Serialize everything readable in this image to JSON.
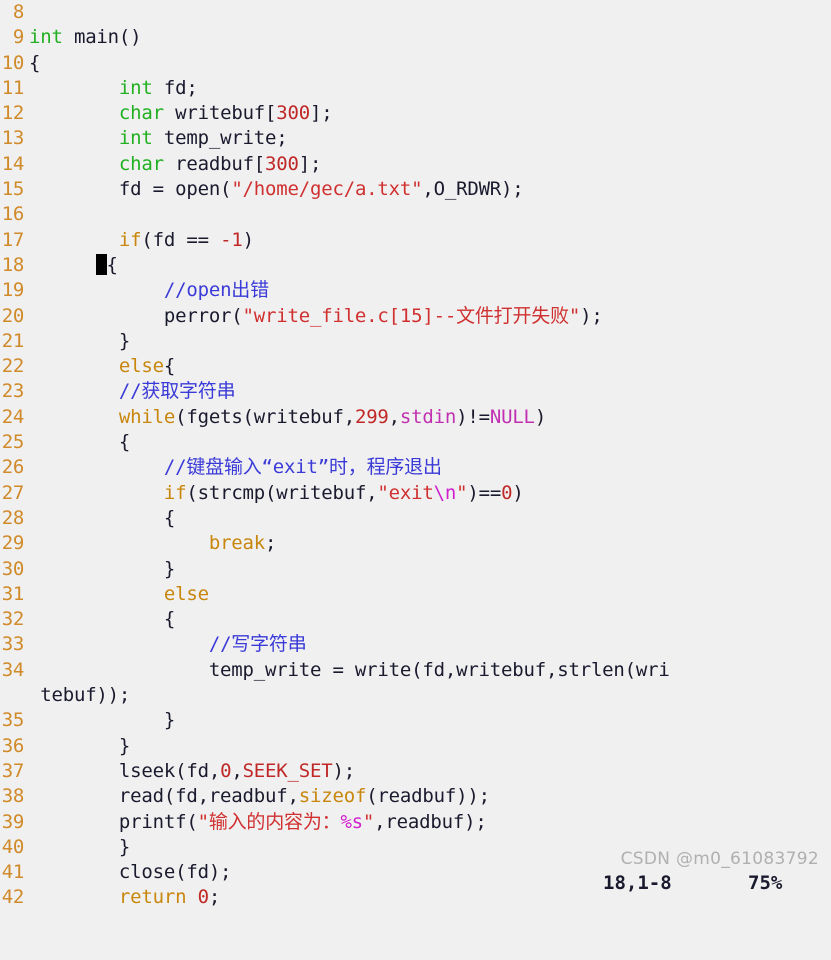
{
  "editor": {
    "background": "#f0f0f0",
    "foreground": "#1a1a2e",
    "gutter_color": "#d08a2a",
    "comment_color": "#3a3ad8",
    "string_color": "#d03030",
    "keyword_color": "#c8860d",
    "type_color": "#21b021",
    "escape_color": "#d020d0"
  },
  "lines": [
    {
      "num": "8",
      "segments": []
    },
    {
      "num": "9",
      "segments": [
        {
          "t": "int",
          "c": "typ"
        },
        {
          "t": " main()",
          "c": "pln"
        }
      ]
    },
    {
      "num": "10",
      "segments": [
        {
          "t": "{",
          "c": "pln"
        }
      ]
    },
    {
      "num": "11",
      "segments": [
        {
          "t": "        ",
          "c": "pln"
        },
        {
          "t": "int",
          "c": "typ"
        },
        {
          "t": " fd;",
          "c": "pln"
        }
      ]
    },
    {
      "num": "12",
      "segments": [
        {
          "t": "        ",
          "c": "pln"
        },
        {
          "t": "char",
          "c": "typ"
        },
        {
          "t": " writebuf[",
          "c": "pln"
        },
        {
          "t": "300",
          "c": "num"
        },
        {
          "t": "];",
          "c": "pln"
        }
      ]
    },
    {
      "num": "13",
      "segments": [
        {
          "t": "        ",
          "c": "pln"
        },
        {
          "t": "int",
          "c": "typ"
        },
        {
          "t": " temp_write;",
          "c": "pln"
        }
      ]
    },
    {
      "num": "14",
      "segments": [
        {
          "t": "        ",
          "c": "pln"
        },
        {
          "t": "char",
          "c": "typ"
        },
        {
          "t": " readbuf[",
          "c": "pln"
        },
        {
          "t": "300",
          "c": "num"
        },
        {
          "t": "];",
          "c": "pln"
        }
      ]
    },
    {
      "num": "15",
      "segments": [
        {
          "t": "        fd = open(",
          "c": "pln"
        },
        {
          "t": "\"/home/gec/a.txt\"",
          "c": "str"
        },
        {
          "t": ",O_RDWR);",
          "c": "pln"
        }
      ]
    },
    {
      "num": "16",
      "segments": []
    },
    {
      "num": "17",
      "segments": [
        {
          "t": "        ",
          "c": "pln"
        },
        {
          "t": "if",
          "c": "kw"
        },
        {
          "t": "(fd == ",
          "c": "pln"
        },
        {
          "t": "-1",
          "c": "num"
        },
        {
          "t": ")",
          "c": "pln"
        }
      ]
    },
    {
      "num": "18",
      "segments": [
        {
          "t": "      ",
          "c": "pln"
        },
        {
          "t": "",
          "c": "cursor"
        },
        {
          "t": "{",
          "c": "pln"
        }
      ]
    },
    {
      "num": "19",
      "segments": [
        {
          "t": "            ",
          "c": "pln"
        },
        {
          "t": "//open出错",
          "c": "cmt"
        }
      ]
    },
    {
      "num": "20",
      "segments": [
        {
          "t": "            perror(",
          "c": "pln"
        },
        {
          "t": "\"write_file.c[15]--文件打开失败\"",
          "c": "str"
        },
        {
          "t": ");",
          "c": "pln"
        }
      ]
    },
    {
      "num": "21",
      "segments": [
        {
          "t": "        }",
          "c": "pln"
        }
      ]
    },
    {
      "num": "22",
      "segments": [
        {
          "t": "        ",
          "c": "pln"
        },
        {
          "t": "else",
          "c": "kw"
        },
        {
          "t": "{",
          "c": "pln"
        }
      ]
    },
    {
      "num": "23",
      "segments": [
        {
          "t": "        ",
          "c": "pln"
        },
        {
          "t": "//获取字符串",
          "c": "cmt"
        }
      ]
    },
    {
      "num": "24",
      "segments": [
        {
          "t": "        ",
          "c": "pln"
        },
        {
          "t": "while",
          "c": "kw"
        },
        {
          "t": "(fgets(writebuf,",
          "c": "pln"
        },
        {
          "t": "299",
          "c": "num"
        },
        {
          "t": ",",
          "c": "pln"
        },
        {
          "t": "stdin",
          "c": "pcst"
        },
        {
          "t": ")!=",
          "c": "pln"
        },
        {
          "t": "NULL",
          "c": "pcst"
        },
        {
          "t": ")",
          "c": "pln"
        }
      ]
    },
    {
      "num": "25",
      "segments": [
        {
          "t": "        {",
          "c": "pln"
        }
      ]
    },
    {
      "num": "26",
      "segments": [
        {
          "t": "            ",
          "c": "pln"
        },
        {
          "t": "//键盘输入“exit”时，程序退出",
          "c": "cmt"
        }
      ]
    },
    {
      "num": "27",
      "segments": [
        {
          "t": "            ",
          "c": "pln"
        },
        {
          "t": "if",
          "c": "kw"
        },
        {
          "t": "(strcmp(writebuf,",
          "c": "pln"
        },
        {
          "t": "\"exit",
          "c": "str"
        },
        {
          "t": "\\n",
          "c": "esc"
        },
        {
          "t": "\"",
          "c": "str"
        },
        {
          "t": ")==",
          "c": "pln"
        },
        {
          "t": "0",
          "c": "num"
        },
        {
          "t": ")",
          "c": "pln"
        }
      ]
    },
    {
      "num": "28",
      "segments": [
        {
          "t": "            {",
          "c": "pln"
        }
      ]
    },
    {
      "num": "29",
      "segments": [
        {
          "t": "                ",
          "c": "pln"
        },
        {
          "t": "break",
          "c": "kw"
        },
        {
          "t": ";",
          "c": "pln"
        }
      ]
    },
    {
      "num": "30",
      "segments": [
        {
          "t": "            }",
          "c": "pln"
        }
      ]
    },
    {
      "num": "31",
      "segments": [
        {
          "t": "            ",
          "c": "pln"
        },
        {
          "t": "else",
          "c": "kw"
        }
      ]
    },
    {
      "num": "32",
      "segments": [
        {
          "t": "            {",
          "c": "pln"
        }
      ]
    },
    {
      "num": "33",
      "segments": [
        {
          "t": "                ",
          "c": "pln"
        },
        {
          "t": "//写字符串",
          "c": "cmt"
        }
      ]
    },
    {
      "num": "34",
      "segments": [
        {
          "t": "                temp_write = write(fd,writebuf,strlen(wri",
          "c": "pln"
        }
      ]
    },
    {
      "num": "",
      "wrap": true,
      "segments": [
        {
          "t": " tebuf));",
          "c": "pln"
        }
      ]
    },
    {
      "num": "35",
      "segments": [
        {
          "t": "            }",
          "c": "pln"
        }
      ]
    },
    {
      "num": "36",
      "segments": [
        {
          "t": "        }",
          "c": "pln"
        }
      ]
    },
    {
      "num": "37",
      "segments": [
        {
          "t": "        lseek(fd,",
          "c": "pln"
        },
        {
          "t": "0",
          "c": "num"
        },
        {
          "t": ",",
          "c": "pln"
        },
        {
          "t": "SEEK_SET",
          "c": "cst"
        },
        {
          "t": ");",
          "c": "pln"
        }
      ]
    },
    {
      "num": "38",
      "segments": [
        {
          "t": "        read(fd,readbuf,",
          "c": "pln"
        },
        {
          "t": "sizeof",
          "c": "kw"
        },
        {
          "t": "(readbuf));",
          "c": "pln"
        }
      ]
    },
    {
      "num": "39",
      "segments": [
        {
          "t": "        printf(",
          "c": "pln"
        },
        {
          "t": "\"输入的内容为：",
          "c": "str"
        },
        {
          "t": "%s",
          "c": "esc"
        },
        {
          "t": "\"",
          "c": "str"
        },
        {
          "t": ",readbuf);",
          "c": "pln"
        }
      ]
    },
    {
      "num": "40",
      "segments": [
        {
          "t": "        }",
          "c": "pln"
        }
      ]
    },
    {
      "num": "41",
      "segments": [
        {
          "t": "        close(fd);",
          "c": "pln"
        }
      ]
    },
    {
      "num": "42",
      "segments": [
        {
          "t": "        ",
          "c": "pln"
        },
        {
          "t": "return",
          "c": "kw"
        },
        {
          "t": " ",
          "c": "pln"
        },
        {
          "t": "0",
          "c": "num"
        },
        {
          "t": ";",
          "c": "pln"
        }
      ]
    }
  ],
  "watermark": {
    "text": "CSDN @m0_61083792"
  },
  "statusline": {
    "position": "18,1-8",
    "percent": "75%"
  }
}
